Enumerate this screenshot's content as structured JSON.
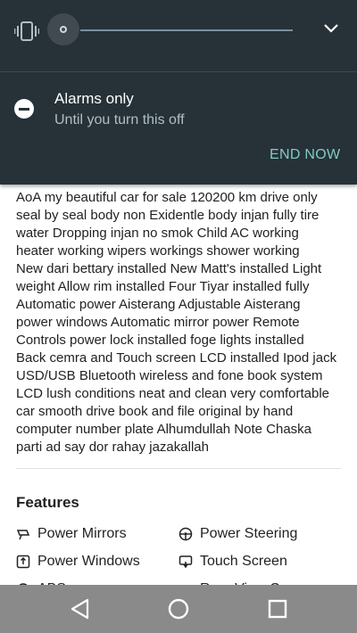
{
  "volume_panel": {
    "level": 0,
    "vibrate_icon": "vibrate-icon",
    "expand_icon": "chevron-down-icon"
  },
  "dnd": {
    "title": "Alarms only",
    "subtitle": "Until you turn this off",
    "end_now_label": "END NOW",
    "icon": "do-not-disturb-icon"
  },
  "listing": {
    "description": "AoA my beautiful car for sale 120200 km drive only\nseal by seal body non Exidentle body injan fully tire\nwater Dropping injan no smok Child AC working\nheater working wipers workings shower  working\nNew dari bettary installed New Matt's installed Light\nweight Allow rim installed Four Tiyar  installed fully\nAutomatic power Aisterang Adjustable Aisterang\npower windows Automatic mirror power Remote\nControls power lock installed foge lights installed\nBack cemra and Touch screen LCD installed Ipod jack\nUSD/USB Bluetooth wireless  and fone book system\nLCD lush conditions neat and clean very comfortable\ncar smooth drive book and file original by hand\ncomputer number plate Alhumdullah Note Chaska\nparti ad say dor rahay jazakallah",
    "features_title": "Features",
    "features": [
      {
        "label": "Power Mirrors",
        "icon": "mirror-icon"
      },
      {
        "label": "Power Steering",
        "icon": "steering-wheel-icon"
      },
      {
        "label": "Power Windows",
        "icon": "window-icon"
      },
      {
        "label": "Touch Screen",
        "icon": "touch-screen-icon"
      },
      {
        "label": "ABS",
        "icon": "abs-icon"
      },
      {
        "label": "Rear View Camera",
        "icon": "camera-icon"
      }
    ]
  },
  "colors": {
    "panel_bg": "#263238",
    "accent": "#80cbc4",
    "navbar_bg": "#8a8a8a"
  }
}
